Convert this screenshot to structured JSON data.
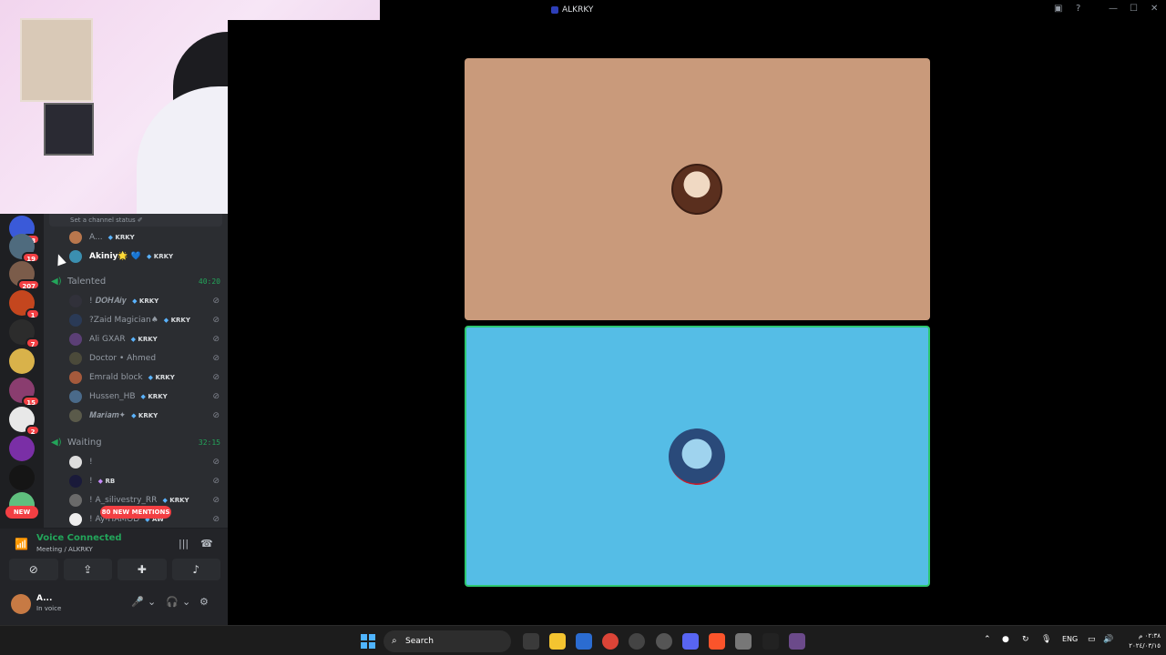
{
  "window": {
    "title": "ALKRKY"
  },
  "channel_status_placeholder": "Set a channel status ✐",
  "servers": [
    {
      "badge": "98"
    },
    {
      "badge": "19"
    },
    {
      "badge": "207"
    },
    {
      "badge": "1"
    },
    {
      "badge": "7"
    },
    {
      "badge": ""
    },
    {
      "badge": "15"
    },
    {
      "badge": "2"
    },
    {
      "badge": ""
    },
    {
      "badge": ""
    },
    {
      "badge": ""
    }
  ],
  "server_new_label": "NEW",
  "top_users": [
    {
      "name": "A...",
      "tag": "KRKY"
    },
    {
      "name": "Akiniy🌟 💙",
      "tag": "KRKY"
    }
  ],
  "voice_channels": [
    {
      "name": "Talented",
      "time": "40:20",
      "users": [
        {
          "name": "! 𝑫𝑶𝑯𝑨𝒊𝒚",
          "tag": "KRKY"
        },
        {
          "name": "?Zaid Magician♠",
          "tag": "KRKY"
        },
        {
          "name": "Ali GXAR",
          "tag": "KRKY"
        },
        {
          "name": "Doctor • Ahmed",
          "tag": ""
        },
        {
          "name": "Emrald block",
          "tag": "KRKY"
        },
        {
          "name": "Hussen_HB",
          "tag": "KRKY"
        },
        {
          "name": "𝑴𝒂𝒓𝒊𝒂𝒎✦",
          "tag": "KRKY"
        }
      ]
    },
    {
      "name": "Waiting",
      "time": "32:15",
      "users": [
        {
          "name": "!",
          "tag": ""
        },
        {
          "name": "!",
          "tag": "RB"
        },
        {
          "name": "! A_silivestry_RR",
          "tag": "KRKY"
        },
        {
          "name": "! Ay-HAMOD",
          "tag": "AW"
        }
      ]
    }
  ],
  "mentions_label": "80 NEW MENTIONS",
  "voice_panel": {
    "status": "Voice Connected",
    "location": "Meeting / ALKRKY"
  },
  "user_panel": {
    "name": "A...",
    "status": "In voice"
  },
  "taskbar": {
    "search_label": "Search",
    "lang": "ENG",
    "time": "٠٢:٣٨ م",
    "date": "٢٠٢٤/٠٣/١٥"
  },
  "colors": {
    "tile_a_bg": "#c99a7b",
    "tile_b_bg": "#55bde6",
    "speaking_border": "#2dc770",
    "voice_green": "#23a55a",
    "mention_red": "#f23f43"
  }
}
